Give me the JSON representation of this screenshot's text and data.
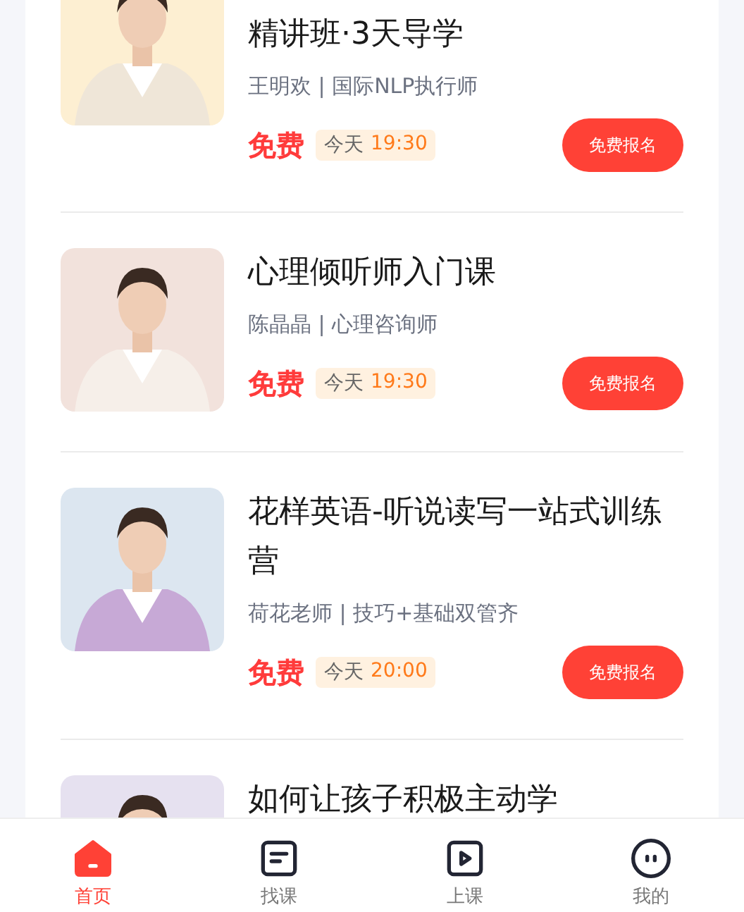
{
  "courses": [
    {
      "title": "精讲班·3天导学",
      "teacher": "王明欢 | 国际NLP执行师",
      "price": "免费",
      "day": "今天",
      "time": "19:30",
      "button": "免费报名"
    },
    {
      "title": "心理倾听师入门课",
      "teacher": "陈晶晶 | 心理咨询师",
      "price": "免费",
      "day": "今天",
      "time": "19:30",
      "button": "免费报名"
    },
    {
      "title": "花样英语-听说读写一站式训练营",
      "teacher": "荷花老师 | 技巧+基础双管齐",
      "price": "免费",
      "day": "今天",
      "time": "20:00",
      "button": "免费报名"
    },
    {
      "title": "如何让孩子积极主动学"
    }
  ],
  "tabbar": [
    {
      "label": "首页",
      "selected": true
    },
    {
      "label": "找课",
      "selected": false
    },
    {
      "label": "上课",
      "selected": false
    },
    {
      "label": "我的",
      "selected": false
    }
  ]
}
